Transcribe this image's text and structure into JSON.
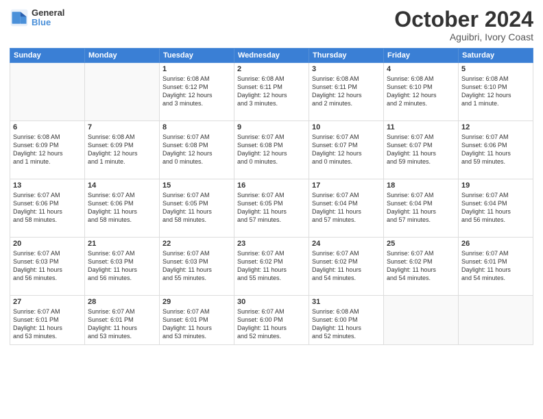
{
  "header": {
    "logo_line1": "General",
    "logo_line2": "Blue",
    "month_title": "October 2024",
    "location": "Aguibri, Ivory Coast"
  },
  "weekdays": [
    "Sunday",
    "Monday",
    "Tuesday",
    "Wednesday",
    "Thursday",
    "Friday",
    "Saturday"
  ],
  "days": [
    {
      "date": null,
      "info": ""
    },
    {
      "date": null,
      "info": ""
    },
    {
      "date": "1",
      "info": "Sunrise: 6:08 AM\nSunset: 6:12 PM\nDaylight: 12 hours\nand 3 minutes."
    },
    {
      "date": "2",
      "info": "Sunrise: 6:08 AM\nSunset: 6:11 PM\nDaylight: 12 hours\nand 3 minutes."
    },
    {
      "date": "3",
      "info": "Sunrise: 6:08 AM\nSunset: 6:11 PM\nDaylight: 12 hours\nand 2 minutes."
    },
    {
      "date": "4",
      "info": "Sunrise: 6:08 AM\nSunset: 6:10 PM\nDaylight: 12 hours\nand 2 minutes."
    },
    {
      "date": "5",
      "info": "Sunrise: 6:08 AM\nSunset: 6:10 PM\nDaylight: 12 hours\nand 1 minute."
    },
    {
      "date": "6",
      "info": "Sunrise: 6:08 AM\nSunset: 6:09 PM\nDaylight: 12 hours\nand 1 minute."
    },
    {
      "date": "7",
      "info": "Sunrise: 6:08 AM\nSunset: 6:09 PM\nDaylight: 12 hours\nand 1 minute."
    },
    {
      "date": "8",
      "info": "Sunrise: 6:07 AM\nSunset: 6:08 PM\nDaylight: 12 hours\nand 0 minutes."
    },
    {
      "date": "9",
      "info": "Sunrise: 6:07 AM\nSunset: 6:08 PM\nDaylight: 12 hours\nand 0 minutes."
    },
    {
      "date": "10",
      "info": "Sunrise: 6:07 AM\nSunset: 6:07 PM\nDaylight: 12 hours\nand 0 minutes."
    },
    {
      "date": "11",
      "info": "Sunrise: 6:07 AM\nSunset: 6:07 PM\nDaylight: 11 hours\nand 59 minutes."
    },
    {
      "date": "12",
      "info": "Sunrise: 6:07 AM\nSunset: 6:06 PM\nDaylight: 11 hours\nand 59 minutes."
    },
    {
      "date": "13",
      "info": "Sunrise: 6:07 AM\nSunset: 6:06 PM\nDaylight: 11 hours\nand 58 minutes."
    },
    {
      "date": "14",
      "info": "Sunrise: 6:07 AM\nSunset: 6:06 PM\nDaylight: 11 hours\nand 58 minutes."
    },
    {
      "date": "15",
      "info": "Sunrise: 6:07 AM\nSunset: 6:05 PM\nDaylight: 11 hours\nand 58 minutes."
    },
    {
      "date": "16",
      "info": "Sunrise: 6:07 AM\nSunset: 6:05 PM\nDaylight: 11 hours\nand 57 minutes."
    },
    {
      "date": "17",
      "info": "Sunrise: 6:07 AM\nSunset: 6:04 PM\nDaylight: 11 hours\nand 57 minutes."
    },
    {
      "date": "18",
      "info": "Sunrise: 6:07 AM\nSunset: 6:04 PM\nDaylight: 11 hours\nand 57 minutes."
    },
    {
      "date": "19",
      "info": "Sunrise: 6:07 AM\nSunset: 6:04 PM\nDaylight: 11 hours\nand 56 minutes."
    },
    {
      "date": "20",
      "info": "Sunrise: 6:07 AM\nSunset: 6:03 PM\nDaylight: 11 hours\nand 56 minutes."
    },
    {
      "date": "21",
      "info": "Sunrise: 6:07 AM\nSunset: 6:03 PM\nDaylight: 11 hours\nand 56 minutes."
    },
    {
      "date": "22",
      "info": "Sunrise: 6:07 AM\nSunset: 6:03 PM\nDaylight: 11 hours\nand 55 minutes."
    },
    {
      "date": "23",
      "info": "Sunrise: 6:07 AM\nSunset: 6:02 PM\nDaylight: 11 hours\nand 55 minutes."
    },
    {
      "date": "24",
      "info": "Sunrise: 6:07 AM\nSunset: 6:02 PM\nDaylight: 11 hours\nand 54 minutes."
    },
    {
      "date": "25",
      "info": "Sunrise: 6:07 AM\nSunset: 6:02 PM\nDaylight: 11 hours\nand 54 minutes."
    },
    {
      "date": "26",
      "info": "Sunrise: 6:07 AM\nSunset: 6:01 PM\nDaylight: 11 hours\nand 54 minutes."
    },
    {
      "date": "27",
      "info": "Sunrise: 6:07 AM\nSunset: 6:01 PM\nDaylight: 11 hours\nand 53 minutes."
    },
    {
      "date": "28",
      "info": "Sunrise: 6:07 AM\nSunset: 6:01 PM\nDaylight: 11 hours\nand 53 minutes."
    },
    {
      "date": "29",
      "info": "Sunrise: 6:07 AM\nSunset: 6:01 PM\nDaylight: 11 hours\nand 53 minutes."
    },
    {
      "date": "30",
      "info": "Sunrise: 6:07 AM\nSunset: 6:00 PM\nDaylight: 11 hours\nand 52 minutes."
    },
    {
      "date": "31",
      "info": "Sunrise: 6:08 AM\nSunset: 6:00 PM\nDaylight: 11 hours\nand 52 minutes."
    },
    {
      "date": null,
      "info": ""
    },
    {
      "date": null,
      "info": ""
    },
    {
      "date": null,
      "info": ""
    }
  ]
}
